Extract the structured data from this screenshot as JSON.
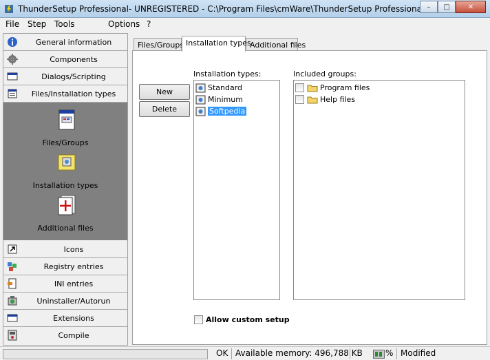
{
  "window": {
    "title": "ThunderSetup Professional- UNREGISTERED - C:\\Program Files\\cmWare\\ThunderSetup Professional\\default...",
    "minimize": "–",
    "maximize": "□",
    "close": "✕"
  },
  "menu": {
    "file": "File",
    "step": "Step",
    "tools": "Tools",
    "options": "Options",
    "help": "?"
  },
  "sidebar": {
    "top": [
      {
        "label": "General information",
        "icon": "info-icon"
      },
      {
        "label": "Components",
        "icon": "gear-icon"
      },
      {
        "label": "Dialogs/Scripting",
        "icon": "dialog-icon"
      },
      {
        "label": "Files/Installation types",
        "icon": "files-icon"
      }
    ],
    "expanded": [
      {
        "label": "Files/Groups",
        "icon": "document-icon"
      },
      {
        "label": "Installation types",
        "icon": "installer-icon"
      },
      {
        "label": "Additional files",
        "icon": "add-file-icon"
      }
    ],
    "bottom": [
      {
        "label": "Icons",
        "icon": "shortcut-icon"
      },
      {
        "label": "Registry entries",
        "icon": "registry-icon"
      },
      {
        "label": "INI entries",
        "icon": "ini-icon"
      },
      {
        "label": "Uninstaller/Autorun",
        "icon": "uninstaller-icon"
      },
      {
        "label": "Extensions",
        "icon": "extension-icon"
      },
      {
        "label": "Compile",
        "icon": "compile-icon"
      }
    ]
  },
  "tabs": {
    "files_groups": "Files/Groups",
    "installation_types": "Installation types",
    "additional_files": "Additional files",
    "active": "Installation types"
  },
  "buttons": {
    "new": "New",
    "delete": "Delete"
  },
  "installation_types": {
    "label": "Installation types:",
    "items": [
      {
        "text": "Standard",
        "selected": false
      },
      {
        "text": "Minimum",
        "selected": false
      },
      {
        "text": "Softpedia",
        "selected": true
      }
    ]
  },
  "included_groups": {
    "label": "Included groups:",
    "items": [
      {
        "text": "Program files",
        "checked": false
      },
      {
        "text": "Help files",
        "checked": false
      }
    ]
  },
  "custom_setup": {
    "label": "Allow custom setup",
    "checked": false
  },
  "statusbar": {
    "progress": 0,
    "status": "OK",
    "memory": "Available memory: 496,788 KB",
    "percent": "%",
    "state": "Modified"
  },
  "colors": {
    "selection": "#3399ff",
    "sidebar_group": "#808080"
  }
}
